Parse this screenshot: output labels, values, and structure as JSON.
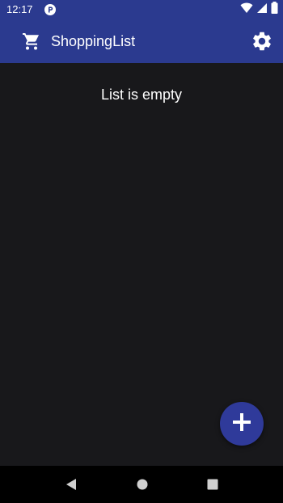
{
  "status_bar": {
    "time": "12:17",
    "icons": [
      "app-notification-icon",
      "wifi-icon",
      "cell-signal-icon",
      "battery-icon"
    ]
  },
  "app_bar": {
    "title": "ShoppingList",
    "leading_icon": "cart-icon",
    "action_icon": "settings-gear-icon",
    "background": "#2b3a8f"
  },
  "main": {
    "empty_message": "List is empty",
    "background": "#18181b"
  },
  "fab": {
    "icon": "plus-icon",
    "color": "#2f3a9a"
  },
  "navigation_bar": {
    "buttons": [
      "back-icon",
      "home-icon",
      "recents-icon"
    ]
  }
}
